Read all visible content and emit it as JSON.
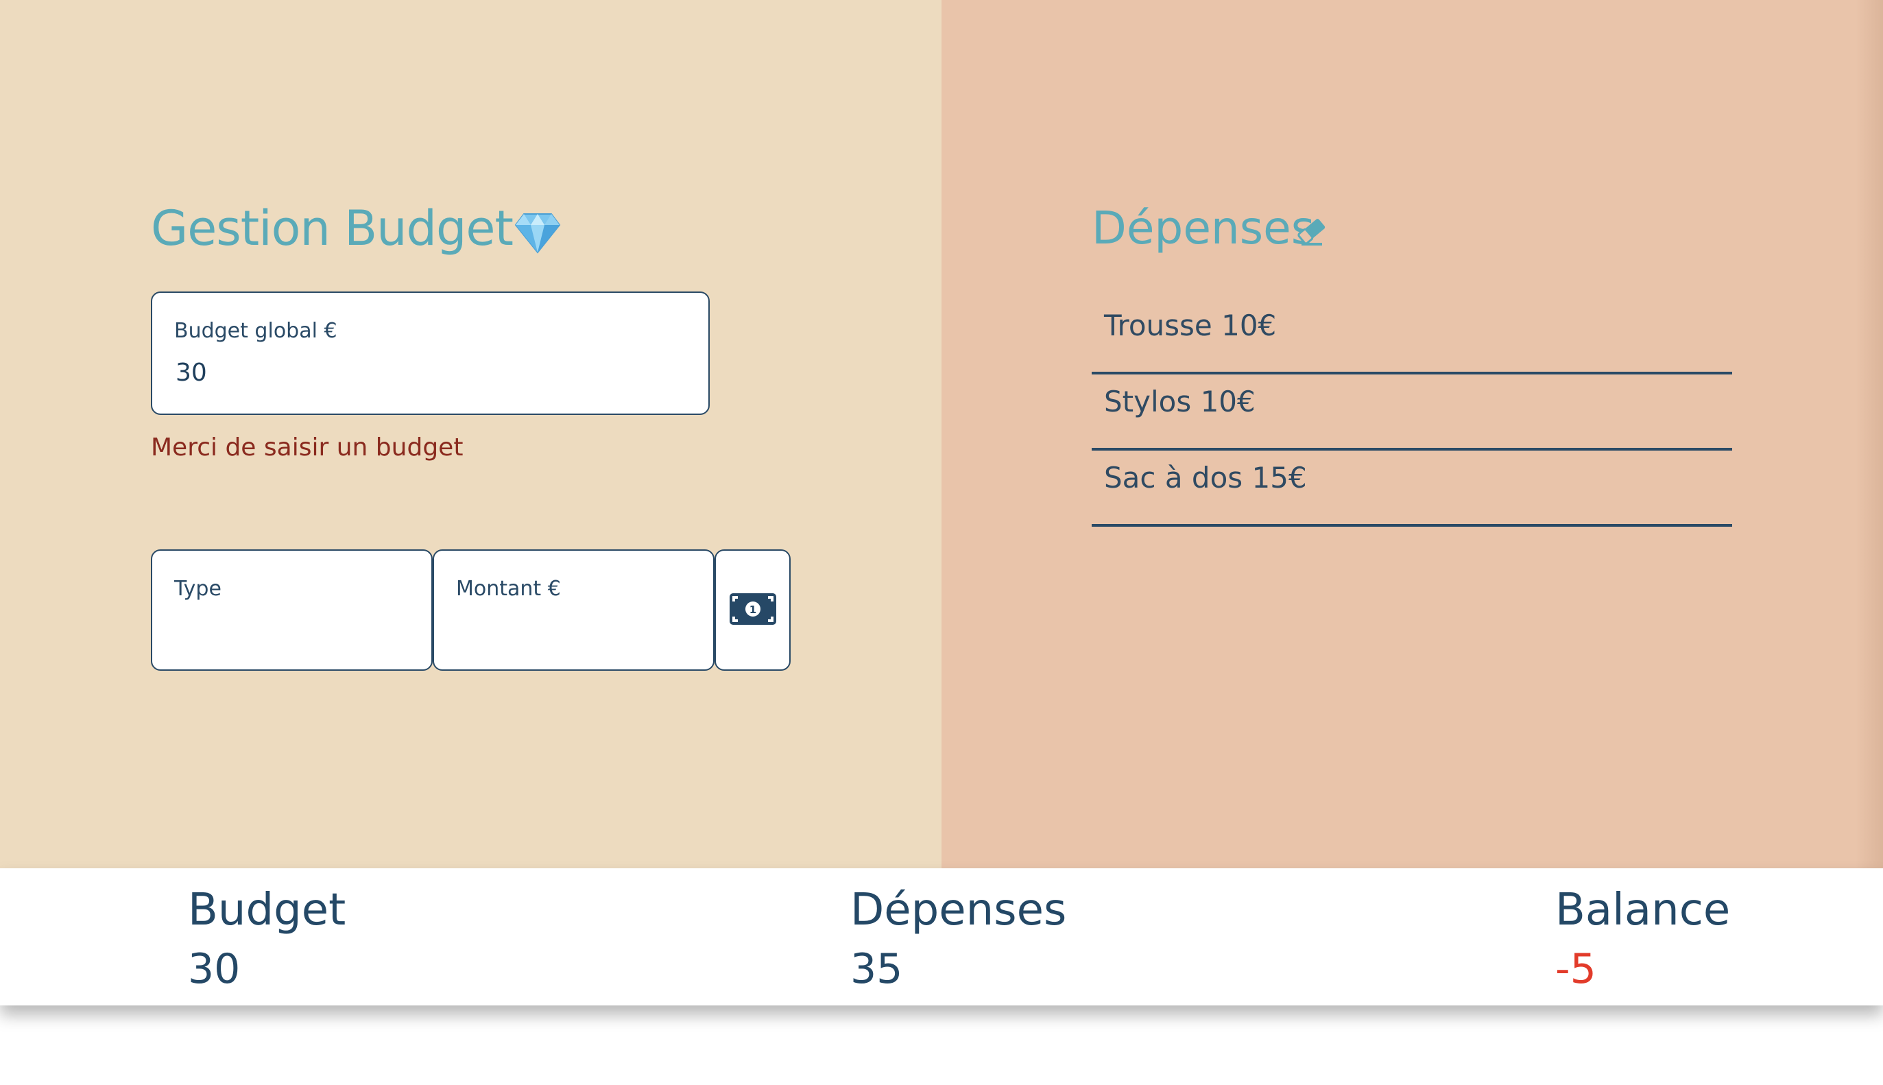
{
  "colors": {
    "left_panel_bg": "#eddbbf",
    "right_panel_bg": "#e9c4aa",
    "title_color": "#5aaab8",
    "text_dark": "#244866",
    "error_color": "#8a2a1e",
    "negative_color": "#e23b2a"
  },
  "budget_form": {
    "title": "Gestion Budget",
    "title_icon": "gem-icon",
    "budget_label": "Budget global €",
    "budget_value": "30",
    "error_message": "Merci de saisir un budget"
  },
  "expense_form": {
    "type_label": "Type",
    "type_value": "",
    "amount_label": "Montant €",
    "amount_value": "",
    "add_button_icon": "money-bill-icon"
  },
  "expenses_panel": {
    "title": "Dépenses",
    "clear_icon": "eraser-icon",
    "items": [
      {
        "label": "Trousse 10€"
      },
      {
        "label": "Stylos 10€"
      },
      {
        "label": "Sac à dos 15€"
      }
    ]
  },
  "summary": {
    "budget_label": "Budget",
    "budget_value": "30",
    "expenses_label": "Dépenses",
    "expenses_value": "35",
    "balance_label": "Balance",
    "balance_value": "-5"
  }
}
